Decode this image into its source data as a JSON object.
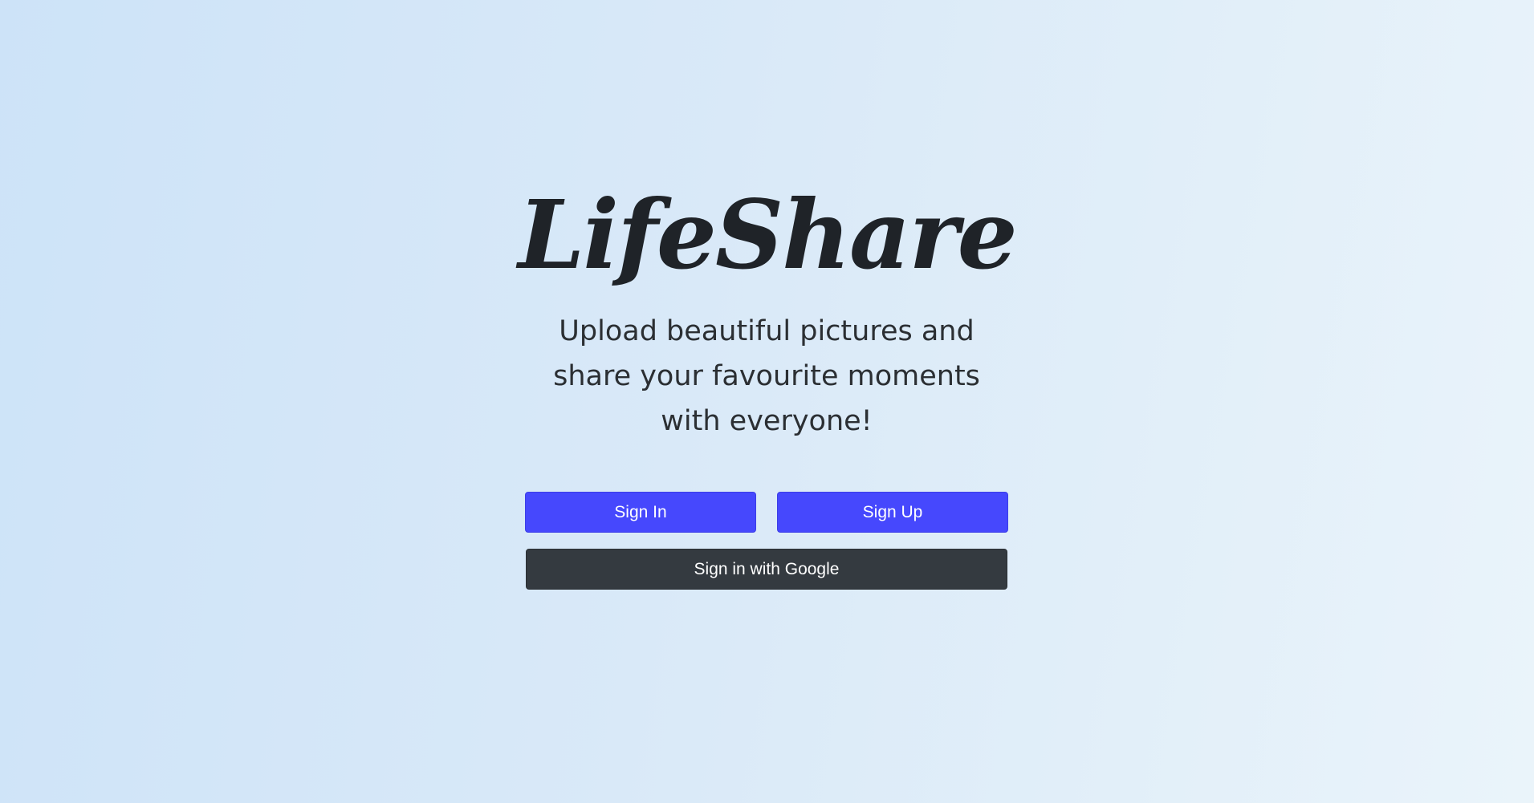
{
  "app": {
    "logo_text": "LifeShare",
    "tagline_lines": [
      "Upload beautiful pictures and",
      "share your favourite moments",
      "with everyone!"
    ]
  },
  "actions": {
    "sign_in_label": "Sign In",
    "sign_up_label": "Sign Up",
    "google_label": "Sign in with Google"
  },
  "colors": {
    "primary_button": "#4648fd",
    "dark_button": "#343a40",
    "background_start": "#cde3f8",
    "background_end": "#eaf4fa"
  }
}
